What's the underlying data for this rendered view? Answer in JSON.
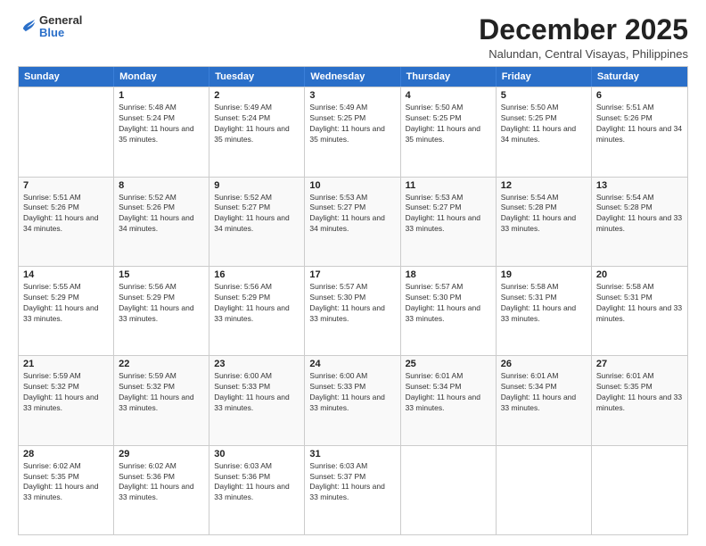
{
  "header": {
    "logo": {
      "general": "General",
      "blue": "Blue"
    },
    "title": "December 2025",
    "location": "Nalundan, Central Visayas, Philippines"
  },
  "calendar": {
    "days_of_week": [
      "Sunday",
      "Monday",
      "Tuesday",
      "Wednesday",
      "Thursday",
      "Friday",
      "Saturday"
    ],
    "weeks": [
      [
        {
          "day": "",
          "sunrise": "",
          "sunset": "",
          "daylight": ""
        },
        {
          "day": "1",
          "sunrise": "Sunrise: 5:48 AM",
          "sunset": "Sunset: 5:24 PM",
          "daylight": "Daylight: 11 hours and 35 minutes."
        },
        {
          "day": "2",
          "sunrise": "Sunrise: 5:49 AM",
          "sunset": "Sunset: 5:24 PM",
          "daylight": "Daylight: 11 hours and 35 minutes."
        },
        {
          "day": "3",
          "sunrise": "Sunrise: 5:49 AM",
          "sunset": "Sunset: 5:25 PM",
          "daylight": "Daylight: 11 hours and 35 minutes."
        },
        {
          "day": "4",
          "sunrise": "Sunrise: 5:50 AM",
          "sunset": "Sunset: 5:25 PM",
          "daylight": "Daylight: 11 hours and 35 minutes."
        },
        {
          "day": "5",
          "sunrise": "Sunrise: 5:50 AM",
          "sunset": "Sunset: 5:25 PM",
          "daylight": "Daylight: 11 hours and 34 minutes."
        },
        {
          "day": "6",
          "sunrise": "Sunrise: 5:51 AM",
          "sunset": "Sunset: 5:26 PM",
          "daylight": "Daylight: 11 hours and 34 minutes."
        }
      ],
      [
        {
          "day": "7",
          "sunrise": "Sunrise: 5:51 AM",
          "sunset": "Sunset: 5:26 PM",
          "daylight": "Daylight: 11 hours and 34 minutes."
        },
        {
          "day": "8",
          "sunrise": "Sunrise: 5:52 AM",
          "sunset": "Sunset: 5:26 PM",
          "daylight": "Daylight: 11 hours and 34 minutes."
        },
        {
          "day": "9",
          "sunrise": "Sunrise: 5:52 AM",
          "sunset": "Sunset: 5:27 PM",
          "daylight": "Daylight: 11 hours and 34 minutes."
        },
        {
          "day": "10",
          "sunrise": "Sunrise: 5:53 AM",
          "sunset": "Sunset: 5:27 PM",
          "daylight": "Daylight: 11 hours and 34 minutes."
        },
        {
          "day": "11",
          "sunrise": "Sunrise: 5:53 AM",
          "sunset": "Sunset: 5:27 PM",
          "daylight": "Daylight: 11 hours and 33 minutes."
        },
        {
          "day": "12",
          "sunrise": "Sunrise: 5:54 AM",
          "sunset": "Sunset: 5:28 PM",
          "daylight": "Daylight: 11 hours and 33 minutes."
        },
        {
          "day": "13",
          "sunrise": "Sunrise: 5:54 AM",
          "sunset": "Sunset: 5:28 PM",
          "daylight": "Daylight: 11 hours and 33 minutes."
        }
      ],
      [
        {
          "day": "14",
          "sunrise": "Sunrise: 5:55 AM",
          "sunset": "Sunset: 5:29 PM",
          "daylight": "Daylight: 11 hours and 33 minutes."
        },
        {
          "day": "15",
          "sunrise": "Sunrise: 5:56 AM",
          "sunset": "Sunset: 5:29 PM",
          "daylight": "Daylight: 11 hours and 33 minutes."
        },
        {
          "day": "16",
          "sunrise": "Sunrise: 5:56 AM",
          "sunset": "Sunset: 5:29 PM",
          "daylight": "Daylight: 11 hours and 33 minutes."
        },
        {
          "day": "17",
          "sunrise": "Sunrise: 5:57 AM",
          "sunset": "Sunset: 5:30 PM",
          "daylight": "Daylight: 11 hours and 33 minutes."
        },
        {
          "day": "18",
          "sunrise": "Sunrise: 5:57 AM",
          "sunset": "Sunset: 5:30 PM",
          "daylight": "Daylight: 11 hours and 33 minutes."
        },
        {
          "day": "19",
          "sunrise": "Sunrise: 5:58 AM",
          "sunset": "Sunset: 5:31 PM",
          "daylight": "Daylight: 11 hours and 33 minutes."
        },
        {
          "day": "20",
          "sunrise": "Sunrise: 5:58 AM",
          "sunset": "Sunset: 5:31 PM",
          "daylight": "Daylight: 11 hours and 33 minutes."
        }
      ],
      [
        {
          "day": "21",
          "sunrise": "Sunrise: 5:59 AM",
          "sunset": "Sunset: 5:32 PM",
          "daylight": "Daylight: 11 hours and 33 minutes."
        },
        {
          "day": "22",
          "sunrise": "Sunrise: 5:59 AM",
          "sunset": "Sunset: 5:32 PM",
          "daylight": "Daylight: 11 hours and 33 minutes."
        },
        {
          "day": "23",
          "sunrise": "Sunrise: 6:00 AM",
          "sunset": "Sunset: 5:33 PM",
          "daylight": "Daylight: 11 hours and 33 minutes."
        },
        {
          "day": "24",
          "sunrise": "Sunrise: 6:00 AM",
          "sunset": "Sunset: 5:33 PM",
          "daylight": "Daylight: 11 hours and 33 minutes."
        },
        {
          "day": "25",
          "sunrise": "Sunrise: 6:01 AM",
          "sunset": "Sunset: 5:34 PM",
          "daylight": "Daylight: 11 hours and 33 minutes."
        },
        {
          "day": "26",
          "sunrise": "Sunrise: 6:01 AM",
          "sunset": "Sunset: 5:34 PM",
          "daylight": "Daylight: 11 hours and 33 minutes."
        },
        {
          "day": "27",
          "sunrise": "Sunrise: 6:01 AM",
          "sunset": "Sunset: 5:35 PM",
          "daylight": "Daylight: 11 hours and 33 minutes."
        }
      ],
      [
        {
          "day": "28",
          "sunrise": "Sunrise: 6:02 AM",
          "sunset": "Sunset: 5:35 PM",
          "daylight": "Daylight: 11 hours and 33 minutes."
        },
        {
          "day": "29",
          "sunrise": "Sunrise: 6:02 AM",
          "sunset": "Sunset: 5:36 PM",
          "daylight": "Daylight: 11 hours and 33 minutes."
        },
        {
          "day": "30",
          "sunrise": "Sunrise: 6:03 AM",
          "sunset": "Sunset: 5:36 PM",
          "daylight": "Daylight: 11 hours and 33 minutes."
        },
        {
          "day": "31",
          "sunrise": "Sunrise: 6:03 AM",
          "sunset": "Sunset: 5:37 PM",
          "daylight": "Daylight: 11 hours and 33 minutes."
        },
        {
          "day": "",
          "sunrise": "",
          "sunset": "",
          "daylight": ""
        },
        {
          "day": "",
          "sunrise": "",
          "sunset": "",
          "daylight": ""
        },
        {
          "day": "",
          "sunrise": "",
          "sunset": "",
          "daylight": ""
        }
      ]
    ]
  }
}
